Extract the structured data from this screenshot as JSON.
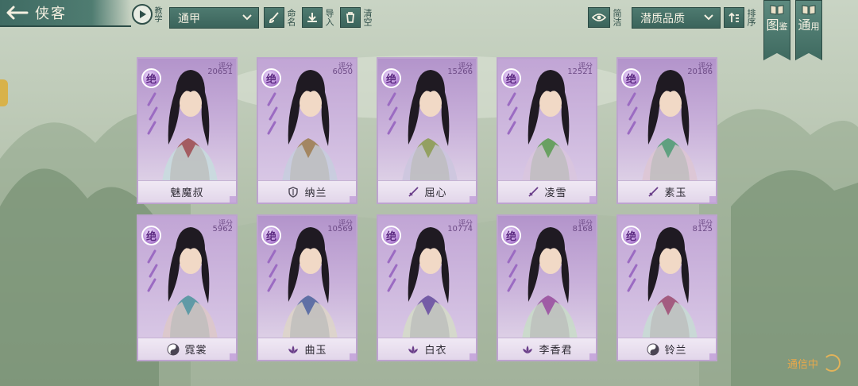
{
  "header": {
    "title": "侠客",
    "tutorial_label": "教学",
    "filter_select": "通甲",
    "rename_label": "命名",
    "import_label": "导入",
    "clear_label": "清空",
    "simple_label": "简洁",
    "sort_select": "潜质品质",
    "sort_label": "排序",
    "codex_label_1": "图",
    "codex_label_2": "鉴",
    "general_label_1": "通",
    "general_label_2": "用"
  },
  "cards": [
    {
      "name": "魅魔叔",
      "grade": "绝",
      "score_label": "评分",
      "score": "20651",
      "role_icon": "none",
      "bg": "#b89bd0"
    },
    {
      "name": "纳兰",
      "grade": "绝",
      "score_label": "评分",
      "score": "6050",
      "role_icon": "shield-icon",
      "bg": "#b89bd0"
    },
    {
      "name": "屈心",
      "grade": "绝",
      "score_label": "评分",
      "score": "15266",
      "role_icon": "sword-icon",
      "bg": "#b89bd0"
    },
    {
      "name": "凌雪",
      "grade": "绝",
      "score_label": "评分",
      "score": "12521",
      "role_icon": "sword-icon",
      "bg": "#b89bd0"
    },
    {
      "name": "素玉",
      "grade": "绝",
      "score_label": "评分",
      "score": "20186",
      "role_icon": "sword-icon",
      "bg": "#b89bd0"
    },
    {
      "name": "霓裳",
      "grade": "绝",
      "score_label": "评分",
      "score": "5962",
      "role_icon": "yinyang-icon",
      "bg": "#b89bd0"
    },
    {
      "name": "曲玉",
      "grade": "绝",
      "score_label": "评分",
      "score": "10569",
      "role_icon": "lotus-icon",
      "bg": "#b89bd0"
    },
    {
      "name": "白衣",
      "grade": "绝",
      "score_label": "评分",
      "score": "10774",
      "role_icon": "lotus-icon",
      "bg": "#b89bd0"
    },
    {
      "name": "李香君",
      "grade": "绝",
      "score_label": "评分",
      "score": "8168",
      "role_icon": "lotus-icon",
      "bg": "#b89bd0"
    },
    {
      "name": "铃兰",
      "grade": "绝",
      "score_label": "评分",
      "score": "8125",
      "role_icon": "yinyang-icon",
      "bg": "#b89bd0"
    }
  ],
  "status": {
    "text": "通信中"
  },
  "colors": {
    "accent": "#3f6b63",
    "card_purple": "#d8c6e3",
    "status_orange": "#e8a84a"
  }
}
